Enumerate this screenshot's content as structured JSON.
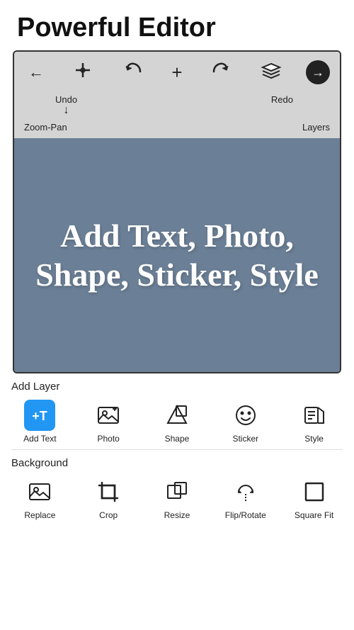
{
  "page": {
    "title": "Powerful Editor"
  },
  "toolbar": {
    "icons": [
      "←",
      "☜",
      "↩",
      "+",
      "↪",
      "⧉",
      "→"
    ],
    "labels": {
      "undo": "Undo",
      "redo": "Redo",
      "zoom_pan": "Zoom-Pan",
      "layers": "Layers"
    }
  },
  "canvas": {
    "text": "Add Text, Photo, Shape, Sticker, Style"
  },
  "add_layer": {
    "section_label": "Add Layer",
    "tools": [
      {
        "id": "add-text",
        "label": "Add Text",
        "icon": "+T",
        "type": "add-text"
      },
      {
        "id": "photo",
        "label": "Photo",
        "icon": "photo",
        "type": "photo"
      },
      {
        "id": "shape",
        "label": "Shape",
        "icon": "shape",
        "type": "shape"
      },
      {
        "id": "sticker",
        "label": "Sticker",
        "icon": "sticker",
        "type": "sticker"
      },
      {
        "id": "style",
        "label": "Style",
        "icon": "style",
        "type": "style"
      }
    ]
  },
  "background": {
    "section_label": "Background",
    "tools": [
      {
        "id": "replace",
        "label": "Replace",
        "icon": "replace",
        "type": "replace"
      },
      {
        "id": "crop",
        "label": "Crop",
        "icon": "crop",
        "type": "crop"
      },
      {
        "id": "resize",
        "label": "Resize",
        "icon": "resize",
        "type": "resize"
      },
      {
        "id": "flip-rotate",
        "label": "Flip/Rotate",
        "icon": "flip",
        "type": "flip"
      },
      {
        "id": "square-fit",
        "label": "Square Fit",
        "icon": "square",
        "type": "square"
      }
    ]
  }
}
